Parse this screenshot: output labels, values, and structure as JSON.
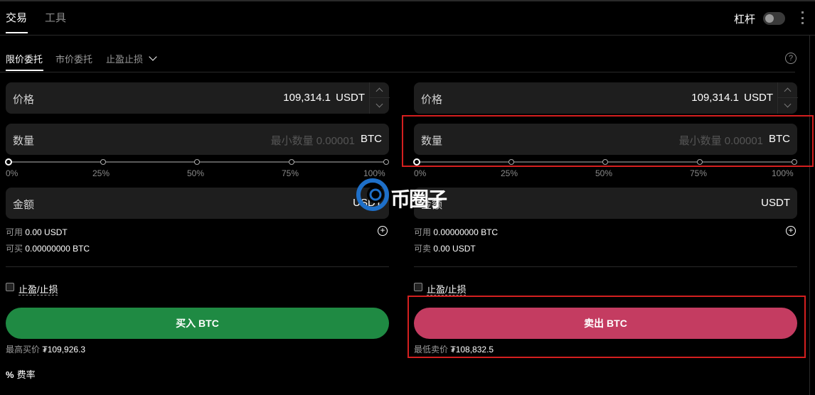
{
  "top_tabs": [
    "交易",
    "工具"
  ],
  "leverage_label": "杠杆",
  "order_types": [
    "限价委托",
    "市价委托",
    "止盈止损"
  ],
  "help_glyph": "?",
  "buy": {
    "price_label": "价格",
    "price_value": "109,314.1",
    "price_unit": "USDT",
    "qty_label": "数量",
    "qty_placeholder": "最小数量 0.00001",
    "qty_unit": "BTC",
    "percent_labels": [
      "0%",
      "25%",
      "50%",
      "75%",
      "100%"
    ],
    "slider_value_pct": 0,
    "amount_label": "金额",
    "amount_unit": "USDT",
    "available_label": "可用",
    "available_value": "0.00 USDT",
    "can_label": "可买",
    "can_value": "0.00000000 BTC",
    "tpsl_label": "止盈/止损",
    "button_label": "买入 BTC",
    "best_label": "最高买价",
    "best_value": "₮109,926.3"
  },
  "sell": {
    "price_label": "价格",
    "price_value": "109,314.1",
    "price_unit": "USDT",
    "qty_label": "数量",
    "qty_placeholder": "最小数量 0.00001",
    "qty_unit": "BTC",
    "percent_labels": [
      "0%",
      "25%",
      "50%",
      "75%",
      "100%"
    ],
    "slider_value_pct": 0,
    "amount_label": "金额",
    "amount_unit": "USDT",
    "available_label": "可用",
    "available_value": "0.00000000 BTC",
    "can_label": "可卖",
    "can_value": "0.00 USDT",
    "tpsl_label": "止盈/止损",
    "button_label": "卖出 BTC",
    "best_label": "最低卖价",
    "best_value": "₮108,832.5"
  },
  "fee_icon": "%",
  "fee_label": "费率",
  "watermark_text": "币圈子",
  "colors": {
    "buy": "#1f8a43",
    "sell": "#c43c61",
    "highlight": "#d41f1f"
  }
}
